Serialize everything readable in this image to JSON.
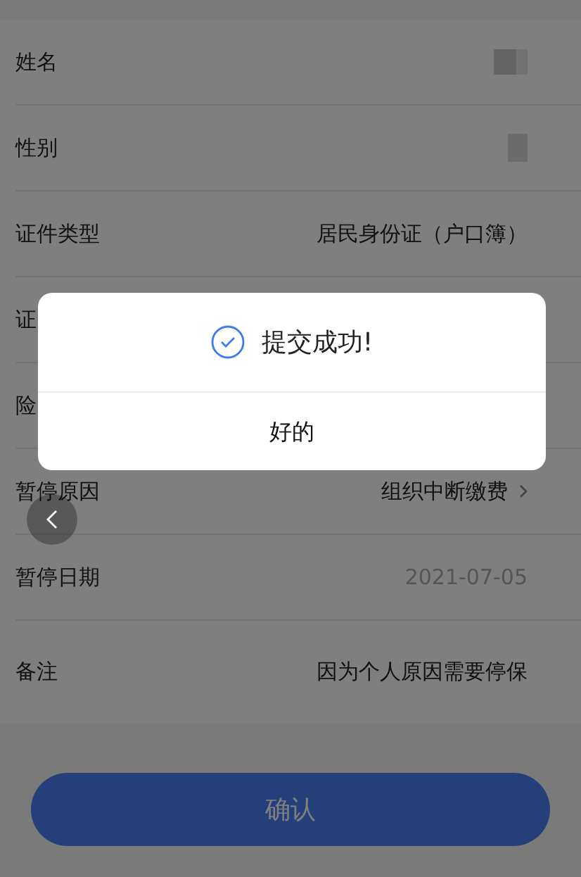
{
  "form": {
    "rows": [
      {
        "label": "姓名",
        "kind": "redacted"
      },
      {
        "label": "性别",
        "kind": "redacted_short"
      },
      {
        "label": "证件类型",
        "kind": "text",
        "value": "居民身份证（户口簿）",
        "muted": false
      },
      {
        "label": "证",
        "kind": "hidden"
      },
      {
        "label": "险",
        "kind": "hidden"
      },
      {
        "label": "暂停原因",
        "kind": "select",
        "value": "组织中断缴费",
        "muted": false
      },
      {
        "label": "暂停日期",
        "kind": "text",
        "value": "2021-07-05",
        "muted": true
      },
      {
        "label": "备注",
        "kind": "text",
        "value": "因为个人原因需要停保",
        "muted": false
      }
    ]
  },
  "confirm_button": {
    "label": "确认"
  },
  "dialog": {
    "message": "提交成功!",
    "button": "好的"
  }
}
